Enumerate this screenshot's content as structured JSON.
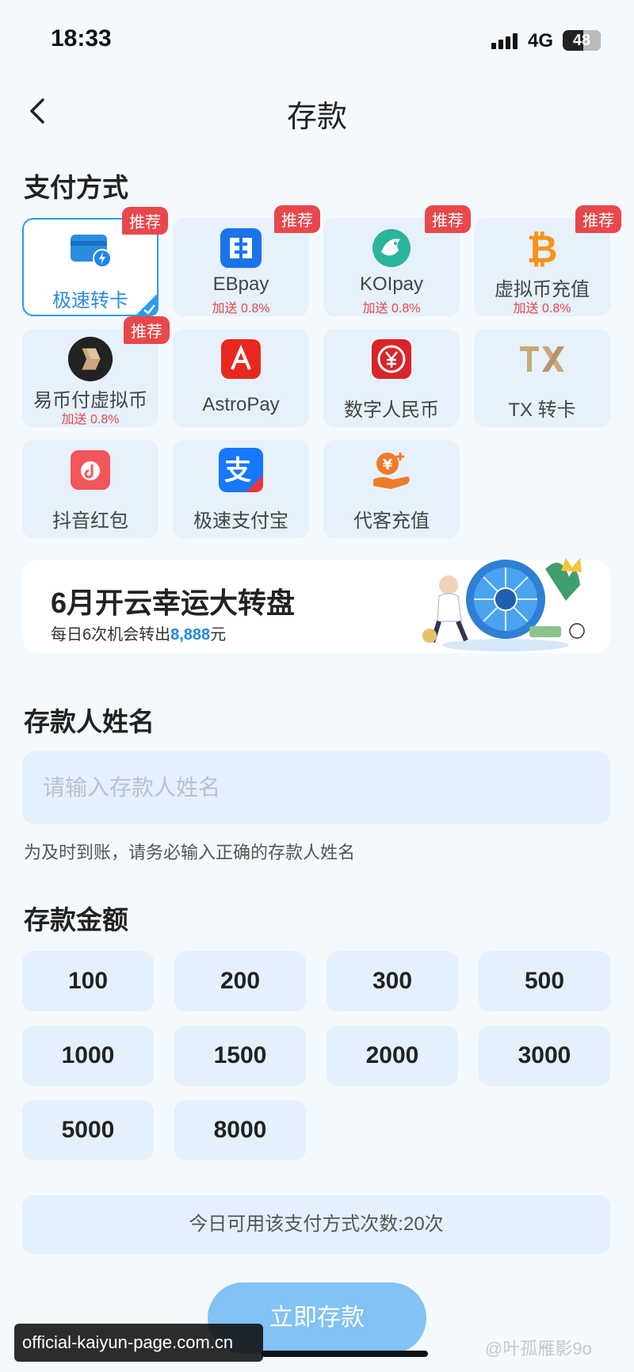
{
  "status_bar": {
    "time": "18:33",
    "network": "4G",
    "battery": "48"
  },
  "nav": {
    "title": "存款"
  },
  "payment_section": {
    "title": "支付方式",
    "methods": [
      {
        "label": "极速转卡",
        "bonus": "",
        "badge": "推荐",
        "icon": "card-lightning-icon",
        "selected": true
      },
      {
        "label": "EBpay",
        "bonus": "加送 0.8%",
        "badge": "推荐",
        "icon": "ebpay-icon"
      },
      {
        "label": "KOIpay",
        "bonus": "加送 0.8%",
        "badge": "推荐",
        "icon": "koi-fish-icon"
      },
      {
        "label": "虚拟币充值",
        "bonus": "加送 0.8%",
        "badge": "推荐",
        "icon": "bitcoin-icon"
      },
      {
        "label": "易币付虚拟币",
        "bonus": "加送 0.8%",
        "badge": "推荐",
        "icon": "yibifu-icon"
      },
      {
        "label": "AstroPay",
        "bonus": "",
        "badge": "",
        "icon": "astropay-icon"
      },
      {
        "label": "数字人民币",
        "bonus": "",
        "badge": "",
        "icon": "digital-rmb-icon"
      },
      {
        "label": "TX 转卡",
        "bonus": "",
        "badge": "",
        "icon": "tx-icon"
      },
      {
        "label": "抖音红包",
        "bonus": "",
        "badge": "",
        "icon": "douyin-redpacket-icon"
      },
      {
        "label": "极速支付宝",
        "bonus": "",
        "badge": "",
        "icon": "alipay-icon"
      },
      {
        "label": "代客充值",
        "bonus": "",
        "badge": "",
        "icon": "agent-topup-icon"
      }
    ]
  },
  "banner": {
    "title": "6月开云幸运大转盘",
    "subtitle_prefix": "每日6次机会转出",
    "subtitle_amount": "8,888",
    "subtitle_suffix": "元"
  },
  "depositor": {
    "title": "存款人姓名",
    "placeholder": "请输入存款人姓名",
    "value": "",
    "hint": "为及时到账，请务必输入正确的存款人姓名"
  },
  "amount": {
    "title": "存款金额",
    "options": [
      "100",
      "200",
      "300",
      "500",
      "1000",
      "1500",
      "2000",
      "3000",
      "5000",
      "8000"
    ]
  },
  "limit_text": "今日可用该支付方式次数:20次",
  "submit_label": "立即存款",
  "overlay_url": "official-kaiyun-page.com.cn",
  "watermark": "@叶孤雁影9o",
  "colors": {
    "accent": "#2b9bf0",
    "badge": "#e8484c",
    "bonus": "#e4464a",
    "submit": "#82c2f4"
  }
}
